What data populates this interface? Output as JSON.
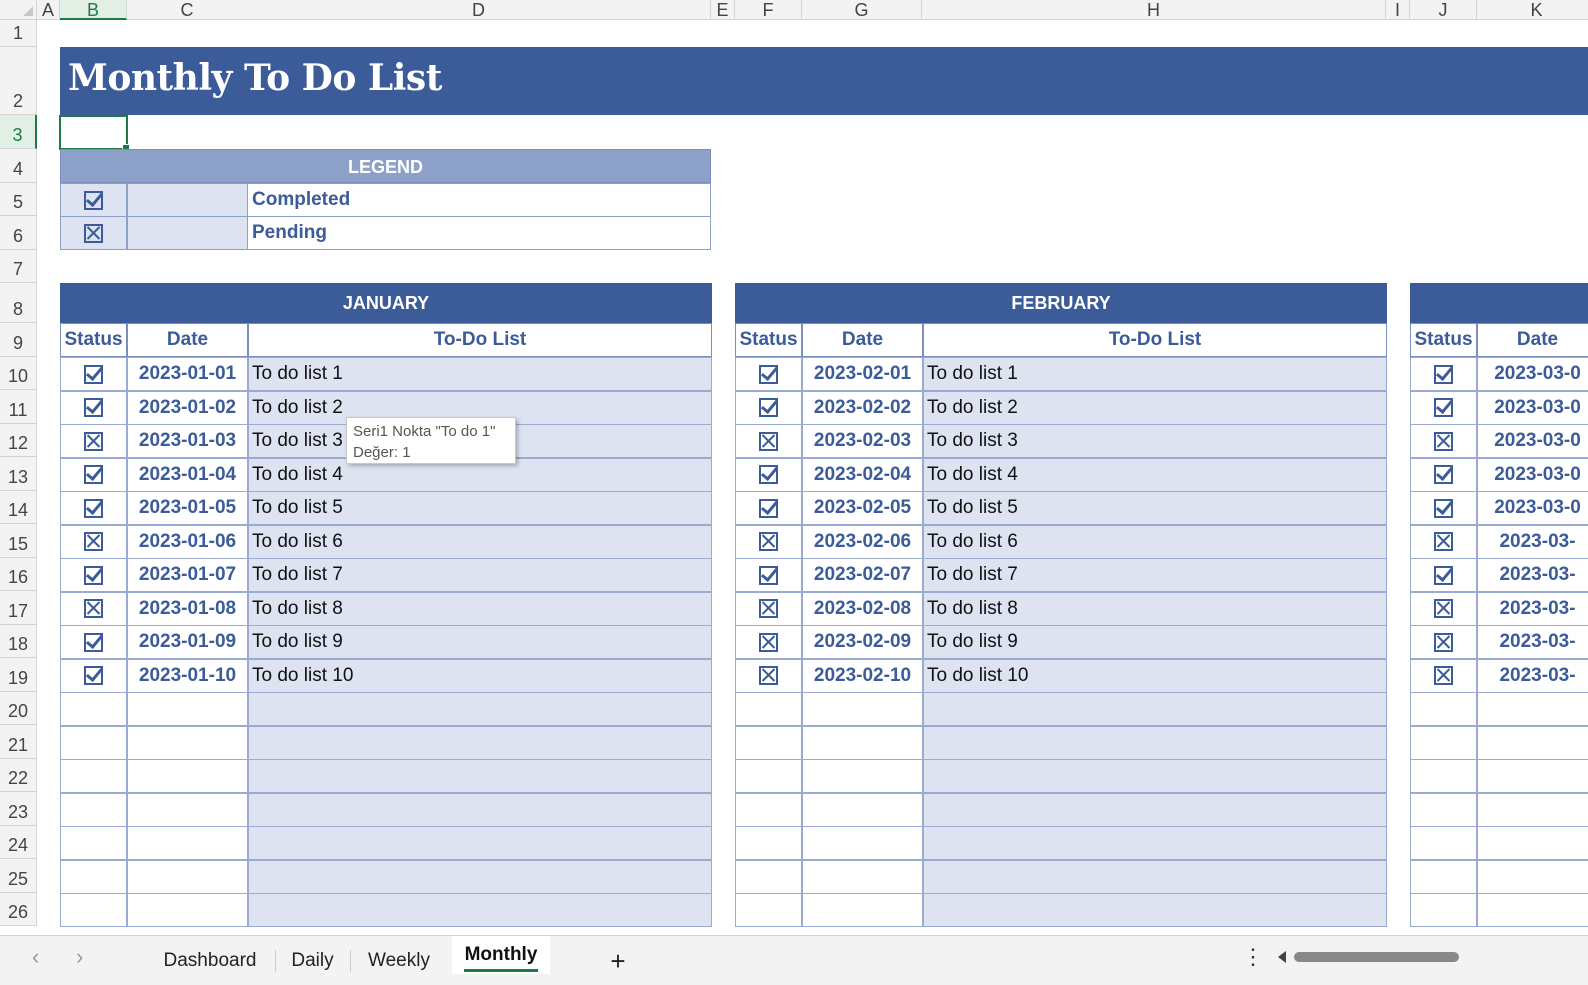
{
  "title": "Monthly To Do List",
  "columns": [
    {
      "letter": "A",
      "selected": false
    },
    {
      "letter": "B",
      "selected": true
    },
    {
      "letter": "C",
      "selected": false
    },
    {
      "letter": "D",
      "selected": false
    },
    {
      "letter": "E",
      "selected": false
    },
    {
      "letter": "F",
      "selected": false
    },
    {
      "letter": "G",
      "selected": false
    },
    {
      "letter": "H",
      "selected": false
    },
    {
      "letter": "I",
      "selected": false
    },
    {
      "letter": "J",
      "selected": false
    },
    {
      "letter": "K",
      "selected": false
    }
  ],
  "rows": [
    "1",
    "2",
    "3",
    "4",
    "5",
    "6",
    "7",
    "8",
    "9",
    "10",
    "11",
    "12",
    "13",
    "14",
    "15",
    "16",
    "17",
    "18",
    "19",
    "20",
    "21",
    "22",
    "23",
    "24",
    "25",
    "26"
  ],
  "selected_row": "3",
  "legend": {
    "header": "LEGEND",
    "items": [
      {
        "status": "done",
        "label": "Completed"
      },
      {
        "status": "pend",
        "label": "Pending"
      }
    ]
  },
  "headers": {
    "status": "Status",
    "date": "Date",
    "todo": "To-Do List"
  },
  "months": [
    {
      "name": "JANUARY",
      "entries": [
        {
          "status": "done",
          "date": "2023-01-01",
          "task": "To do list 1"
        },
        {
          "status": "done",
          "date": "2023-01-02",
          "task": "To do list 2"
        },
        {
          "status": "pend",
          "date": "2023-01-03",
          "task": "To do list 3"
        },
        {
          "status": "done",
          "date": "2023-01-04",
          "task": "To do list 4"
        },
        {
          "status": "done",
          "date": "2023-01-05",
          "task": "To do list 5"
        },
        {
          "status": "pend",
          "date": "2023-01-06",
          "task": "To do list 6"
        },
        {
          "status": "done",
          "date": "2023-01-07",
          "task": "To do list 7"
        },
        {
          "status": "pend",
          "date": "2023-01-08",
          "task": "To do list 8"
        },
        {
          "status": "done",
          "date": "2023-01-09",
          "task": "To do list 9"
        },
        {
          "status": "done",
          "date": "2023-01-10",
          "task": "To do list 10"
        }
      ]
    },
    {
      "name": "FEBRUARY",
      "entries": [
        {
          "status": "done",
          "date": "2023-02-01",
          "task": "To do list 1"
        },
        {
          "status": "done",
          "date": "2023-02-02",
          "task": "To do list 2"
        },
        {
          "status": "pend",
          "date": "2023-02-03",
          "task": "To do list 3"
        },
        {
          "status": "done",
          "date": "2023-02-04",
          "task": "To do list 4"
        },
        {
          "status": "done",
          "date": "2023-02-05",
          "task": "To do list 5"
        },
        {
          "status": "pend",
          "date": "2023-02-06",
          "task": "To do list 6"
        },
        {
          "status": "done",
          "date": "2023-02-07",
          "task": "To do list 7"
        },
        {
          "status": "pend",
          "date": "2023-02-08",
          "task": "To do list 8"
        },
        {
          "status": "pend",
          "date": "2023-02-09",
          "task": "To do list 9"
        },
        {
          "status": "pend",
          "date": "2023-02-10",
          "task": "To do list 10"
        }
      ]
    },
    {
      "name": "",
      "entries": [
        {
          "status": "done",
          "date": "2023-03-0",
          "task": ""
        },
        {
          "status": "done",
          "date": "2023-03-0",
          "task": ""
        },
        {
          "status": "pend",
          "date": "2023-03-0",
          "task": ""
        },
        {
          "status": "done",
          "date": "2023-03-0",
          "task": ""
        },
        {
          "status": "done",
          "date": "2023-03-0",
          "task": ""
        },
        {
          "status": "pend",
          "date": "2023-03-",
          "task": ""
        },
        {
          "status": "done",
          "date": "2023-03-",
          "task": ""
        },
        {
          "status": "pend",
          "date": "2023-03-",
          "task": ""
        },
        {
          "status": "pend",
          "date": "2023-03-",
          "task": ""
        },
        {
          "status": "pend",
          "date": "2023-03-",
          "task": ""
        }
      ]
    }
  ],
  "empty_rows": 7,
  "tooltip": {
    "line1": "Seri1 Nokta \"To do 1\"",
    "line2": "Değer: 1"
  },
  "sheet_tabs": {
    "items": [
      {
        "label": "Dashboard",
        "active": false
      },
      {
        "label": "Daily",
        "active": false
      },
      {
        "label": "Weekly",
        "active": false
      },
      {
        "label": "Monthly",
        "active": true
      }
    ],
    "add_label": "+",
    "prev": "‹",
    "next": "›",
    "more": "⋮"
  },
  "colors": {
    "accent": "#3c5b99",
    "legend": "#8da0c8",
    "row_fill": "#dde3f0",
    "excel_green": "#1e7b45"
  }
}
